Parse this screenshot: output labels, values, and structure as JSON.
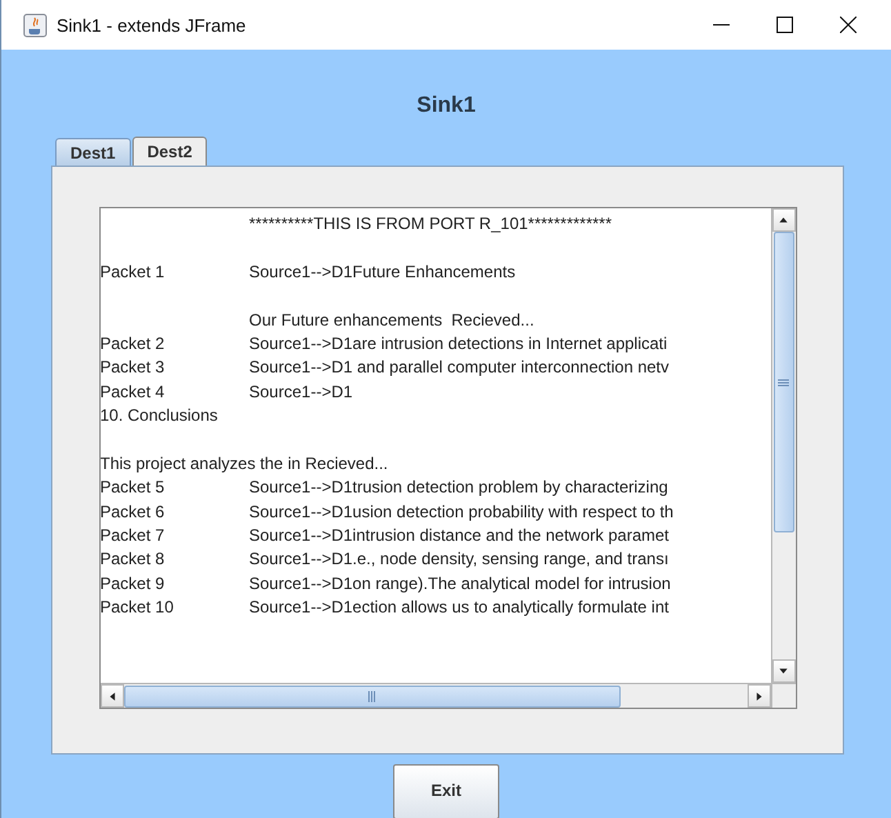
{
  "window": {
    "title": "Sink1 - extends JFrame"
  },
  "heading": "Sink1",
  "tabs": [
    {
      "label": "Dest1",
      "selected": true
    },
    {
      "label": "Dest2",
      "selected": false
    }
  ],
  "log_lines": [
    {
      "kind": "text",
      "message": "**********THIS IS FROM PORT R_101*************"
    },
    {
      "kind": "blank"
    },
    {
      "kind": "text",
      "packet": "Packet 1",
      "message": "Source1-->D1Future Enhancements"
    },
    {
      "kind": "blank"
    },
    {
      "kind": "text",
      "message": "Our Future enhancements  Recieved..."
    },
    {
      "kind": "text",
      "packet": "Packet 2",
      "message": "Source1-->D1are intrusion detections in Internet applicati"
    },
    {
      "kind": "text",
      "packet": "Packet 3",
      "message": "Source1-->D1 and parallel computer interconnection netv"
    },
    {
      "kind": "text",
      "packet": "Packet 4",
      "message": "Source1-->D1"
    },
    {
      "kind": "text",
      "packet": "10. Conclusions"
    },
    {
      "kind": "blank"
    },
    {
      "kind": "text",
      "packet": "This project analyzes the in Recieved..."
    },
    {
      "kind": "text",
      "packet": "Packet 5",
      "message": "Source1-->D1trusion detection problem by characterizing"
    },
    {
      "kind": "text",
      "packet": "Packet 6",
      "message": "Source1-->D1usion detection probability with respect to th"
    },
    {
      "kind": "text",
      "packet": "Packet 7",
      "message": "Source1-->D1intrusion distance and the network paramet"
    },
    {
      "kind": "text",
      "packet": "Packet 8",
      "message": "Source1-->D1.e., node density, sensing range, and transı"
    },
    {
      "kind": "text",
      "packet": "Packet 9",
      "message": "Source1-->D1on range).The analytical model for intrusion"
    },
    {
      "kind": "text",
      "packet": "Packet 10",
      "message": "Source1-->D1ection allows us to analytically formulate int"
    }
  ],
  "buttons": [
    {
      "label": "Exit"
    }
  ]
}
